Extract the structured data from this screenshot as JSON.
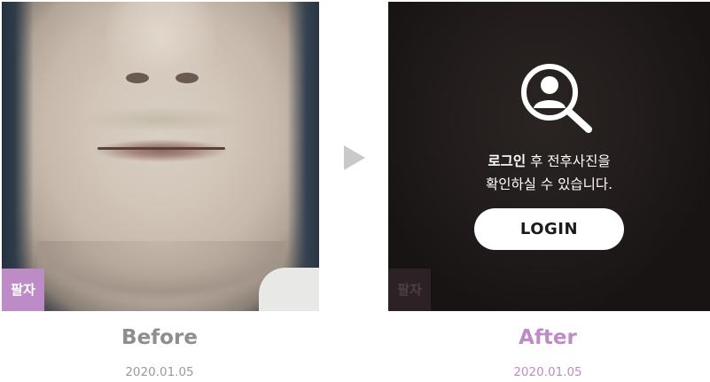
{
  "before": {
    "badge": "팔자",
    "title": "Before",
    "date": "2020.01.05",
    "image_alt": "before-face-photo"
  },
  "after": {
    "badge": "팔자",
    "title": "After",
    "date": "2020.01.05",
    "lock_message_bold": "로그인",
    "lock_message_line1_rest": " 후 전후사진을",
    "lock_message_line2": "확인하실 수 있습니다.",
    "login_button_label": "LOGIN",
    "icon": "user-search-icon"
  },
  "colors": {
    "accent": "#bd8bc6",
    "before_title": "#8e8e8e",
    "arrow": "#c9c9c9",
    "after_overlay": "#1a1616"
  }
}
